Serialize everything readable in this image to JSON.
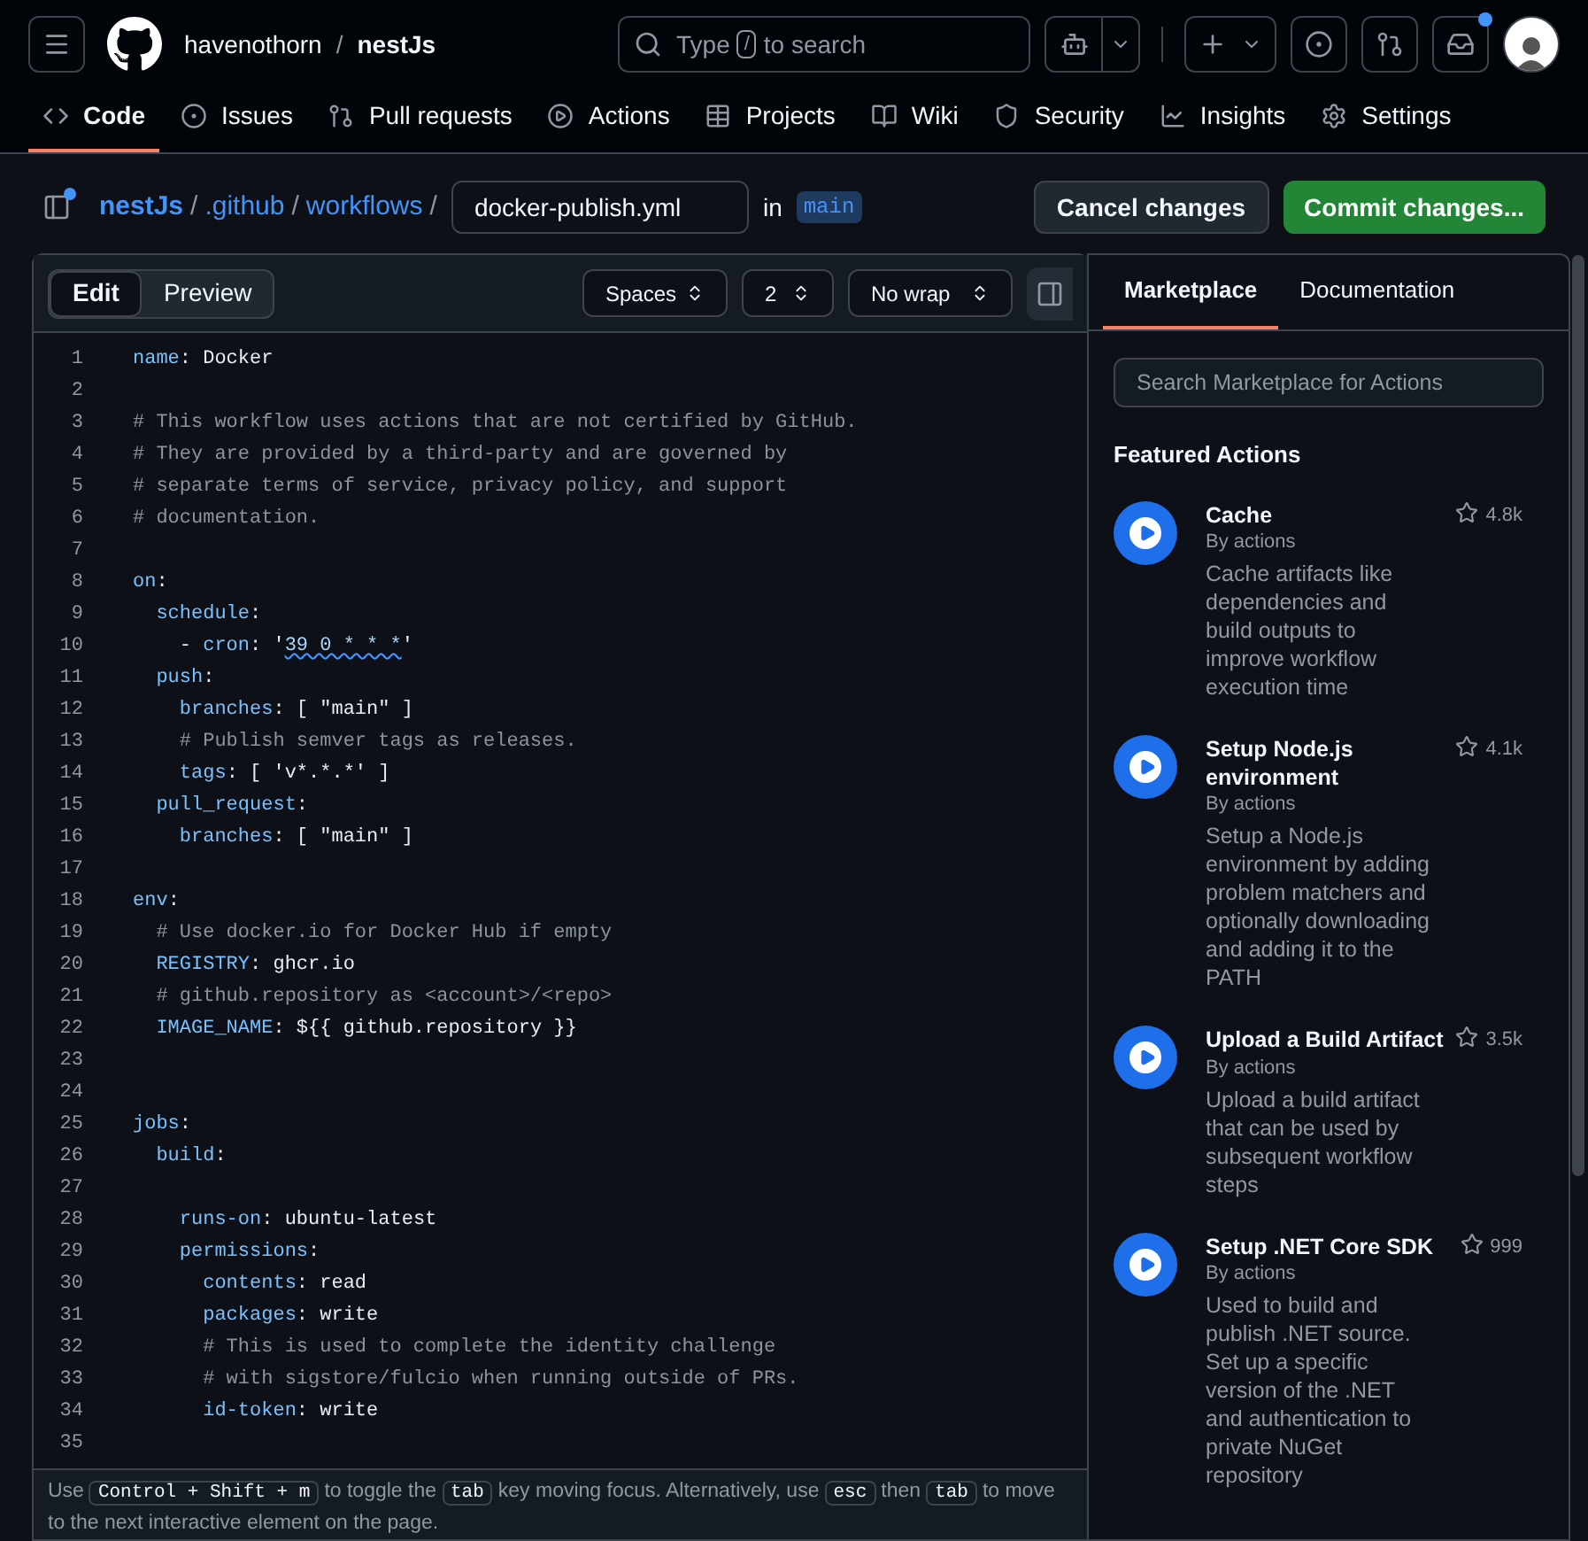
{
  "header": {
    "owner": "havenothorn",
    "separator": "/",
    "repo": "nestJs",
    "search": {
      "before": "Type",
      "key": "/",
      "after": "to search"
    },
    "inbox_unread": true
  },
  "nav": [
    {
      "label": "Code",
      "selected": true
    },
    {
      "label": "Issues",
      "selected": false
    },
    {
      "label": "Pull requests",
      "selected": false
    },
    {
      "label": "Actions",
      "selected": false
    },
    {
      "label": "Projects",
      "selected": false
    },
    {
      "label": "Wiki",
      "selected": false
    },
    {
      "label": "Security",
      "selected": false
    },
    {
      "label": "Insights",
      "selected": false
    },
    {
      "label": "Settings",
      "selected": false
    }
  ],
  "breadcrumb": {
    "path": [
      "nestJs",
      ".github",
      "workflows"
    ],
    "separator": "/",
    "filename": "docker-publish.yml",
    "in": "in",
    "branch": "main",
    "sidebar_dot": true
  },
  "actions": {
    "cancel": "Cancel changes",
    "commit": "Commit changes..."
  },
  "editor": {
    "tabs": [
      {
        "label": "Edit",
        "selected": true
      },
      {
        "label": "Preview",
        "selected": false
      }
    ],
    "selects": [
      "Spaces",
      "2",
      "No wrap"
    ],
    "lines": [
      {
        "num": "1",
        "parts": [
          {
            "kind": "key",
            "text": "name"
          },
          {
            "kind": "plain",
            "text": ": Docker"
          }
        ]
      },
      {
        "num": "2"
      },
      {
        "num": "3",
        "parts": [
          {
            "kind": "comment",
            "text": "# This workflow uses actions that are not certified by GitHub."
          }
        ]
      },
      {
        "num": "4",
        "parts": [
          {
            "kind": "comment",
            "text": "# They are provided by a third-party and are governed by"
          }
        ]
      },
      {
        "num": "5",
        "parts": [
          {
            "kind": "comment",
            "text": "# separate terms of service, privacy policy, and support"
          }
        ]
      },
      {
        "num": "6",
        "parts": [
          {
            "kind": "comment",
            "text": "# documentation."
          }
        ]
      },
      {
        "num": "7"
      },
      {
        "num": "8",
        "parts": [
          {
            "kind": "key",
            "text": "on"
          },
          {
            "kind": "plain",
            "text": ":"
          }
        ]
      },
      {
        "num": "9",
        "parts": [
          {
            "kind": "key",
            "text": "  schedule"
          },
          {
            "kind": "plain",
            "text": ":"
          }
        ]
      },
      {
        "num": "10",
        "parts": [
          {
            "kind": "plain",
            "text": "    - "
          },
          {
            "kind": "key",
            "text": "cron"
          },
          {
            "kind": "plain",
            "text": ": '"
          },
          {
            "kind": "warning",
            "text": "39 0 * * *"
          },
          {
            "kind": "plain",
            "text": "'"
          }
        ]
      },
      {
        "num": "11",
        "parts": [
          {
            "kind": "key",
            "text": "  push"
          },
          {
            "kind": "plain",
            "text": ":"
          }
        ]
      },
      {
        "num": "12",
        "parts": [
          {
            "kind": "key",
            "text": "    branches"
          },
          {
            "kind": "plain",
            "text": ": [ \"main\" ]"
          }
        ]
      },
      {
        "num": "13",
        "parts": [
          {
            "kind": "comment",
            "text": "    # Publish semver tags as releases."
          }
        ]
      },
      {
        "num": "14",
        "parts": [
          {
            "kind": "key",
            "text": "    tags"
          },
          {
            "kind": "plain",
            "text": ": [ 'v*.*.*' ]"
          }
        ]
      },
      {
        "num": "15",
        "parts": [
          {
            "kind": "key",
            "text": "  pull_request"
          },
          {
            "kind": "plain",
            "text": ":"
          }
        ]
      },
      {
        "num": "16",
        "parts": [
          {
            "kind": "key",
            "text": "    branches"
          },
          {
            "kind": "plain",
            "text": ": [ \"main\" ]"
          }
        ]
      },
      {
        "num": "17"
      },
      {
        "num": "18",
        "parts": [
          {
            "kind": "key",
            "text": "env"
          },
          {
            "kind": "plain",
            "text": ":"
          }
        ]
      },
      {
        "num": "19",
        "parts": [
          {
            "kind": "comment",
            "text": "  # Use docker.io for Docker Hub if empty"
          }
        ]
      },
      {
        "num": "20",
        "parts": [
          {
            "kind": "key",
            "text": "  REGISTRY"
          },
          {
            "kind": "plain",
            "text": ": ghcr.io"
          }
        ]
      },
      {
        "num": "21",
        "parts": [
          {
            "kind": "comment",
            "text": "  # github.repository as <account>/<repo>"
          }
        ]
      },
      {
        "num": "22",
        "parts": [
          {
            "kind": "key",
            "text": "  IMAGE_NAME"
          },
          {
            "kind": "plain",
            "text": ": ${{ github.repository }}"
          }
        ]
      },
      {
        "num": "23"
      },
      {
        "num": "24"
      },
      {
        "num": "25",
        "parts": [
          {
            "kind": "key",
            "text": "jobs"
          },
          {
            "kind": "plain",
            "text": ":"
          }
        ]
      },
      {
        "num": "26",
        "parts": [
          {
            "kind": "key",
            "text": "  build"
          },
          {
            "kind": "plain",
            "text": ":"
          }
        ]
      },
      {
        "num": "27"
      },
      {
        "num": "28",
        "parts": [
          {
            "kind": "key",
            "text": "    runs-on"
          },
          {
            "kind": "plain",
            "text": ": ubuntu-latest"
          }
        ]
      },
      {
        "num": "29",
        "parts": [
          {
            "kind": "key",
            "text": "    permissions"
          },
          {
            "kind": "plain",
            "text": ":"
          }
        ]
      },
      {
        "num": "30",
        "parts": [
          {
            "kind": "key",
            "text": "      contents"
          },
          {
            "kind": "plain",
            "text": ": read"
          }
        ]
      },
      {
        "num": "31",
        "parts": [
          {
            "kind": "key",
            "text": "      packages"
          },
          {
            "kind": "plain",
            "text": ": write"
          }
        ]
      },
      {
        "num": "32",
        "parts": [
          {
            "kind": "comment",
            "text": "      # This is used to complete the identity challenge"
          }
        ]
      },
      {
        "num": "33",
        "parts": [
          {
            "kind": "comment",
            "text": "      # with sigstore/fulcio when running outside of PRs."
          }
        ]
      },
      {
        "num": "34",
        "parts": [
          {
            "kind": "key",
            "text": "      id-token"
          },
          {
            "kind": "plain",
            "text": ": write"
          }
        ]
      },
      {
        "num": "35"
      }
    ]
  },
  "help": [
    {
      "kind": "text",
      "text": "Use"
    },
    {
      "kind": "kbd",
      "text": "Control + Shift + m"
    },
    {
      "kind": "text",
      "text": "to toggle the"
    },
    {
      "kind": "kbd",
      "text": "tab"
    },
    {
      "kind": "text",
      "text": "key moving focus. Alternatively, use"
    },
    {
      "kind": "kbd",
      "text": "esc"
    },
    {
      "kind": "text",
      "text": "then"
    },
    {
      "kind": "kbd",
      "text": "tab"
    },
    {
      "kind": "text",
      "text": "to move to the next interactive element on the page."
    }
  ],
  "panel": {
    "tabs": [
      {
        "label": "Marketplace",
        "selected": true
      },
      {
        "label": "Documentation",
        "selected": false
      }
    ],
    "search_placeholder": "Search Marketplace for Actions",
    "heading": "Featured Actions",
    "items": [
      {
        "name": "Cache",
        "by": "By actions",
        "description": "Cache artifacts like dependencies and build outputs to improve workflow execution time",
        "star_count": "4.8k"
      },
      {
        "name": "Setup Node.js environment",
        "by": "By actions",
        "description": "Setup a Node.js environment by adding problem matchers and optionally downloading and adding it to the PATH",
        "star_count": "4.1k"
      },
      {
        "name": "Upload a Build Artifact",
        "by": "By actions",
        "description": "Upload a build artifact that can be used by subsequent workflow steps",
        "star_count": "3.5k"
      },
      {
        "name": "Setup .NET Core SDK",
        "by": "By actions",
        "description": "Used to build and publish .NET source. Set up a specific version of the .NET and authentication to private NuGet repository",
        "star_count": "999"
      }
    ]
  }
}
